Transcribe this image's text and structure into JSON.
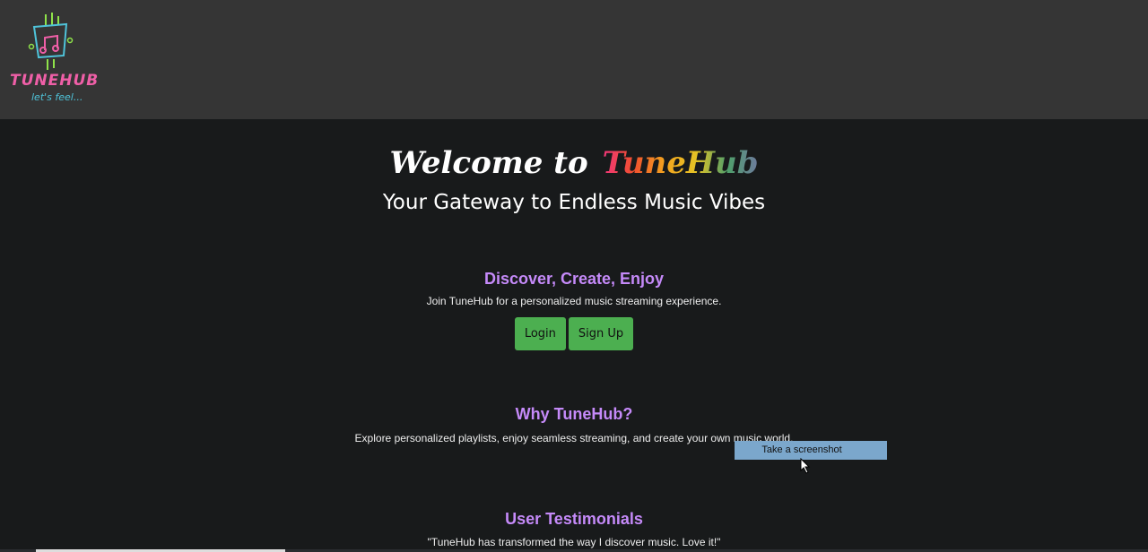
{
  "header": {
    "logo_text": "TUNEHUB",
    "logo_tagline": "let's feel..."
  },
  "hero": {
    "welcome": "Welcome to",
    "brand": "TuneHub",
    "tagline": "Your Gateway to Endless Music Vibes"
  },
  "cta": {
    "title": "Discover, Create, Enjoy",
    "text": "Join TuneHub for a personalized music streaming experience.",
    "login_label": "Login",
    "signup_label": "Sign Up"
  },
  "why": {
    "title": "Why TuneHub?",
    "text": "Explore personalized playlists, enjoy seamless streaming, and create your own music world."
  },
  "testimonials": {
    "title": "User Testimonials",
    "quote": "\"TuneHub has transformed the way I discover music. Love it!\""
  },
  "context_menu": {
    "item": "Take a screenshot"
  },
  "colors": {
    "header_bg": "#353535",
    "page_bg": "#181a1b",
    "heading": "#c58af9",
    "button": "#4caf50"
  }
}
